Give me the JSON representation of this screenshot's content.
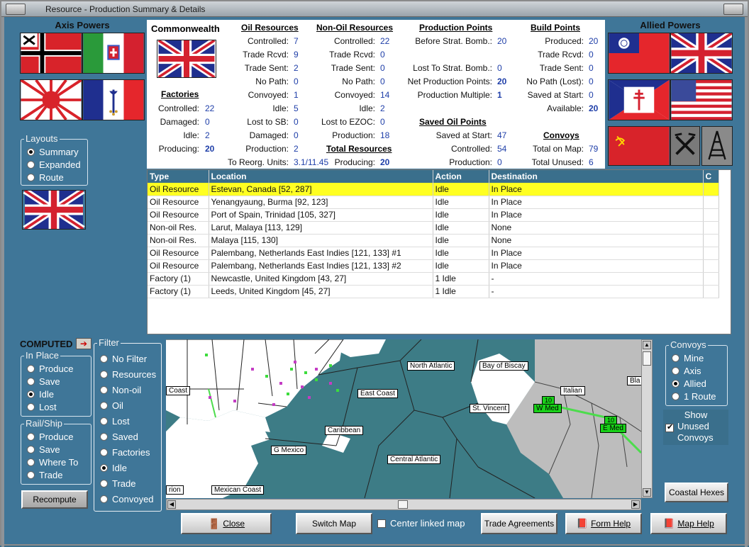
{
  "window": {
    "title": "Resource - Production Summary & Details"
  },
  "axis_title": "Axis Powers",
  "allied_title": "Allied Powers",
  "nation": "Commonwealth",
  "layouts": {
    "title": "Layouts",
    "options": [
      "Summary",
      "Expanded",
      "Route"
    ],
    "selected": 0
  },
  "factories": {
    "header": "Factories",
    "rows": [
      {
        "label": "Controlled:",
        "value": "22"
      },
      {
        "label": "Damaged:",
        "value": "0"
      },
      {
        "label": "Idle:",
        "value": "2"
      },
      {
        "label": "Producing:",
        "value": "20"
      }
    ]
  },
  "oil": {
    "header": "Oil Resources",
    "rows": [
      {
        "label": "Controlled:",
        "value": "7"
      },
      {
        "label": "Trade Rcvd:",
        "value": "9"
      },
      {
        "label": "Trade Sent:",
        "value": "2"
      },
      {
        "label": "No Path:",
        "value": "0"
      },
      {
        "label": "Convoyed:",
        "value": "1"
      },
      {
        "label": "Idle:",
        "value": "5"
      },
      {
        "label": "Lost to SB:",
        "value": "0"
      },
      {
        "label": "Damaged:",
        "value": "0"
      },
      {
        "label": "Production:",
        "value": "2"
      },
      {
        "label": "To Reorg. Units:",
        "value": "3.1/11.45"
      }
    ]
  },
  "nonoil": {
    "header": "Non-Oil Resources",
    "rows": [
      {
        "label": "Controlled:",
        "value": "22"
      },
      {
        "label": "Trade Rcvd:",
        "value": "0"
      },
      {
        "label": "Trade Sent:",
        "value": "0"
      },
      {
        "label": "No Path:",
        "value": "0"
      },
      {
        "label": "Convoyed:",
        "value": "14"
      },
      {
        "label": "Idle:",
        "value": "2"
      },
      {
        "label": "Lost to EZOC:",
        "value": "0"
      },
      {
        "label": "Production:",
        "value": "18"
      }
    ]
  },
  "total": {
    "header": "Total Resources",
    "label": "Producing:",
    "value": "20"
  },
  "pp": {
    "header": "Production Points",
    "rows": [
      {
        "label": "Before Strat. Bomb.:",
        "value": "20"
      },
      {
        "label": "Lost To Strat. Bomb.:",
        "value": "0"
      },
      {
        "label": "Net Production Points:",
        "value": "20"
      },
      {
        "label": "Production Multiple:",
        "value": "1"
      }
    ]
  },
  "saved_oil": {
    "header": "Saved Oil Points",
    "rows": [
      {
        "label": "Saved at Start:",
        "value": "47"
      },
      {
        "label": "Controlled:",
        "value": "54"
      },
      {
        "label": "Production:",
        "value": "0"
      }
    ]
  },
  "bp": {
    "header": "Build Points",
    "rows": [
      {
        "label": "Produced:",
        "value": "20"
      },
      {
        "label": "Trade Rcvd:",
        "value": "0"
      },
      {
        "label": "Trade Sent:",
        "value": "0"
      },
      {
        "label": "No Path (Lost):",
        "value": "0"
      },
      {
        "label": "Saved at Start:",
        "value": "0"
      },
      {
        "label": "Available:",
        "value": "20"
      }
    ]
  },
  "convoys_sum": {
    "header": "Convoys",
    "rows": [
      {
        "label": "Total on Map:",
        "value": "79"
      },
      {
        "label": "Total Unused:",
        "value": "6"
      }
    ]
  },
  "table": {
    "columns": [
      "Type",
      "Location",
      "Action",
      "Destination",
      "C"
    ],
    "rows": [
      [
        "Oil Resource",
        "Estevan, Canada [52, 287]",
        "Idle",
        "In Place",
        ""
      ],
      [
        "Oil Resource",
        "Yenangyaung, Burma [92, 123]",
        "Idle",
        "In Place",
        ""
      ],
      [
        "Oil Resource",
        "Port of Spain, Trinidad [105, 327]",
        "Idle",
        "In Place",
        ""
      ],
      [
        "Non-oil Res.",
        "Larut, Malaya [113, 129]",
        "Idle",
        "None",
        ""
      ],
      [
        "Non-oil Res.",
        "Malaya [115, 130]",
        "Idle",
        "None",
        ""
      ],
      [
        "Oil Resource",
        "Palembang, Netherlands East Indies [121, 133] #1",
        "Idle",
        "In Place",
        ""
      ],
      [
        "Oil Resource",
        "Palembang, Netherlands East Indies [121, 133] #2",
        "Idle",
        "In Place",
        ""
      ],
      [
        "Factory (1)",
        "Newcastle, United Kingdom [43, 27]",
        "1 Idle",
        "-",
        ""
      ],
      [
        "Factory (1)",
        "Leeds, United Kingdom [45, 27]",
        "1 Idle",
        "-",
        ""
      ]
    ],
    "selected_row": 0
  },
  "computed": "COMPUTED",
  "inplace": {
    "title": "In Place",
    "options": [
      "Produce",
      "Save",
      "Idle",
      "Lost"
    ],
    "selected": 2
  },
  "railship": {
    "title": "Rail/Ship",
    "options": [
      "Produce",
      "Save",
      "Where To",
      "Trade"
    ],
    "selected": -1
  },
  "recompute": "Recompute",
  "filter": {
    "title": "Filter",
    "options": [
      "No Filter",
      "Resources",
      "Non-oil",
      "Oil",
      "Lost",
      "Saved",
      "Factories",
      "Idle",
      "Trade",
      "Convoyed"
    ],
    "selected": 7
  },
  "convoys": {
    "title": "Convoys",
    "options": [
      "Mine",
      "Axis",
      "Allied",
      "1 Route"
    ],
    "selected": 2
  },
  "show_unused": {
    "lines": [
      "Show",
      "Unused",
      "Convoys"
    ],
    "checked": true
  },
  "coastal": "Coastal Hexes",
  "map_labels": [
    "North Atlantic",
    "Bay of Biscay",
    "East Coast",
    "Coast",
    "Italian",
    "Bla",
    "St. Vincent",
    "W Med",
    "E Med",
    "Caribbean",
    "G Mexico",
    "Central Atlantic",
    "Mexican Coast",
    "rion"
  ],
  "map_counters": [
    "10",
    "10"
  ],
  "buttons": {
    "close": "Close",
    "switch_map": "Switch Map",
    "center_linked": "Center linked map",
    "trade": "Trade Agreements",
    "form_help": "Form Help",
    "map_help": "Map Help"
  },
  "center_linked_checked": false
}
